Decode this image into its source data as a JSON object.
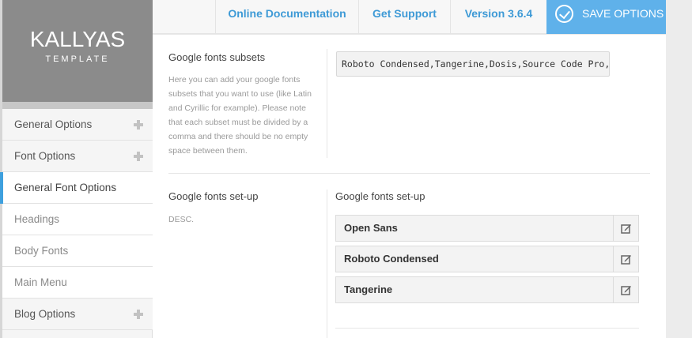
{
  "brand": {
    "name": "KALLYAS",
    "subtitle": "TEMPLATE"
  },
  "topbar": {
    "links": [
      "Online Documentation",
      "Get Support",
      "Version 3.6.4"
    ],
    "save_label": "SAVE OPTIONS"
  },
  "sidebar": {
    "items": [
      {
        "label": "General Options",
        "expandable": true
      },
      {
        "label": "Font Options",
        "expandable": true
      },
      {
        "label": "General Font Options",
        "active": true
      },
      {
        "label": "Headings"
      },
      {
        "label": "Body Fonts"
      },
      {
        "label": "Main Menu"
      },
      {
        "label": "Blog Options",
        "expandable": true
      }
    ]
  },
  "options": {
    "subsets": {
      "title": "Google fonts subsets",
      "desc": "Here you can add your google fonts subsets that you want to use (like Latin and Cyrillic for example). Please note that each subset must be divided by a comma and there should be no empty space between them.",
      "value": "Roboto Condensed,Tangerine,Dosis,Source Code Pro,Rale"
    },
    "setup": {
      "title": "Google fonts set-up",
      "desc": "DESC.",
      "field_label": "Google fonts set-up",
      "fonts": [
        "Open Sans",
        "Roboto Condensed",
        "Tangerine"
      ]
    }
  },
  "colors": {
    "accent": "#3ea0de",
    "save_bg": "#5fb1ea",
    "logo_bg": "#8b8b8b"
  }
}
